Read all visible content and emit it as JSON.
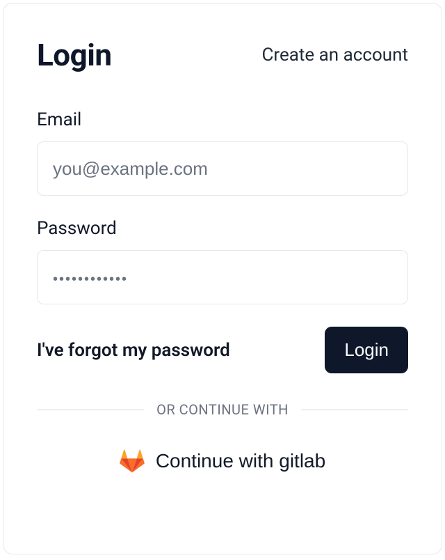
{
  "header": {
    "title": "Login",
    "create_account": "Create an account"
  },
  "form": {
    "email_label": "Email",
    "email_placeholder": "you@example.com",
    "email_value": "",
    "password_label": "Password",
    "password_placeholder": "••••••••••••",
    "password_value": "",
    "forgot": "I've forgot my password",
    "login_button": "Login"
  },
  "divider": {
    "text": "OR CONTINUE WITH"
  },
  "oauth": {
    "gitlab_label": "Continue with gitlab"
  }
}
